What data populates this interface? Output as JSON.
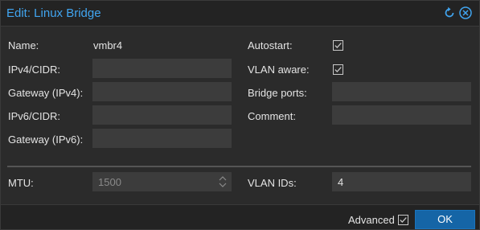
{
  "window": {
    "title": "Edit: Linux Bridge",
    "accent_color": "#41a5f0",
    "tools": [
      {
        "icon": "reset-icon"
      },
      {
        "icon": "close-icon"
      }
    ]
  },
  "form": {
    "left": {
      "name_label": "Name:",
      "name_value": "vmbr4",
      "ipv4_label": "IPv4/CIDR:",
      "ipv4_value": "",
      "gateway4_label": "Gateway (IPv4):",
      "gateway4_value": "",
      "ipv6_label": "IPv6/CIDR:",
      "ipv6_value": "",
      "gateway6_label": "Gateway (IPv6):",
      "gateway6_value": ""
    },
    "right": {
      "autostart_label": "Autostart:",
      "autostart_checked": true,
      "vlan_aware_label": "VLAN aware:",
      "vlan_aware_checked": true,
      "bridge_ports_label": "Bridge ports:",
      "bridge_ports_value": "",
      "comment_label": "Comment:",
      "comment_value": ""
    },
    "advanced": {
      "mtu_label": "MTU:",
      "mtu_value": "1500",
      "vlan_ids_label": "VLAN IDs:",
      "vlan_ids_value": "4"
    }
  },
  "footer": {
    "advanced_label": "Advanced",
    "advanced_checked": true,
    "ok_label": "OK",
    "ok_color": "#1565a6"
  }
}
